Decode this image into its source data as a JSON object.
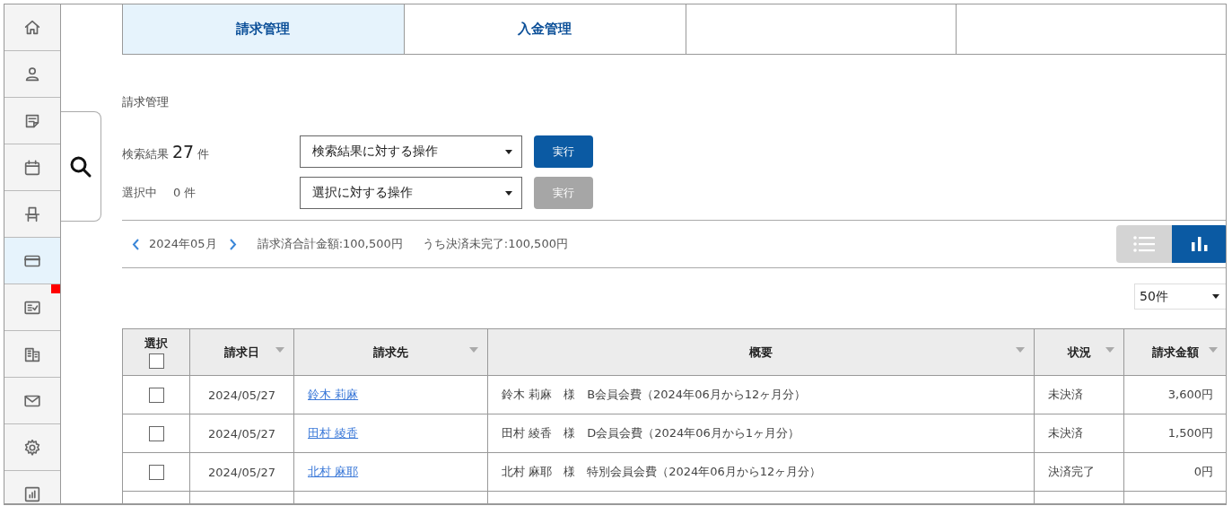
{
  "sidebar": {
    "items": [
      {
        "selected": false,
        "badge": false
      },
      {
        "selected": false,
        "badge": false
      },
      {
        "selected": false,
        "badge": false
      },
      {
        "selected": false,
        "badge": false
      },
      {
        "selected": false,
        "badge": false
      },
      {
        "selected": true,
        "badge": false
      },
      {
        "selected": false,
        "badge": true
      },
      {
        "selected": false,
        "badge": false
      },
      {
        "selected": false,
        "badge": false
      },
      {
        "selected": false,
        "badge": false
      },
      {
        "selected": false,
        "badge": false
      }
    ]
  },
  "tabs": [
    {
      "label": "請求管理",
      "selected": true
    },
    {
      "label": "入金管理",
      "selected": false
    }
  ],
  "page_title": "請求管理",
  "search_result": {
    "label": "検索結果",
    "count": "27",
    "unit": "件",
    "action": {
      "value": "検索結果に対する操作"
    },
    "button": {
      "label": "実行",
      "disabled": false
    }
  },
  "selection": {
    "label": "選択中",
    "count": "0",
    "unit": "件",
    "action": {
      "value": "選択に対する操作"
    },
    "button": {
      "label": "実行",
      "disabled": true
    }
  },
  "period": {
    "month": "2024年05月",
    "total": "請求済合計金額:100,500円",
    "unsettled": "うち決済未完了:100,500円"
  },
  "view_toggle": [
    {
      "kind": "list",
      "selected": false
    },
    {
      "kind": "chart",
      "selected": true
    }
  ],
  "per_page": {
    "value": "50件"
  },
  "table": {
    "select_all": {
      "label": "選択",
      "checked": false
    },
    "columns": [
      {
        "label": "請求日",
        "sortable": true
      },
      {
        "label": "請求先",
        "sortable": true
      },
      {
        "label": "概要",
        "sortable": true
      },
      {
        "label": "状況",
        "sortable": true
      },
      {
        "label": "請求金額",
        "sortable": true
      }
    ],
    "rows": [
      {
        "checked": false,
        "date": "2024/05/27",
        "customer": "鈴木 莉麻",
        "summary": "鈴木 莉麻　様　B会員会費（2024年06月から12ヶ月分）",
        "status": "未決済",
        "amount": "3,600円"
      },
      {
        "checked": false,
        "date": "2024/05/27",
        "customer": "田村 綾香",
        "summary": "田村 綾香　様　D会員会費（2024年06月から1ヶ月分）",
        "status": "未決済",
        "amount": "1,500円"
      },
      {
        "checked": false,
        "date": "2024/05/27",
        "customer": "北村 麻耶",
        "summary": "北村 麻耶　様　特別会員会費（2024年06月から12ヶ月分）",
        "status": "決済完了",
        "amount": "0円"
      }
    ]
  }
}
